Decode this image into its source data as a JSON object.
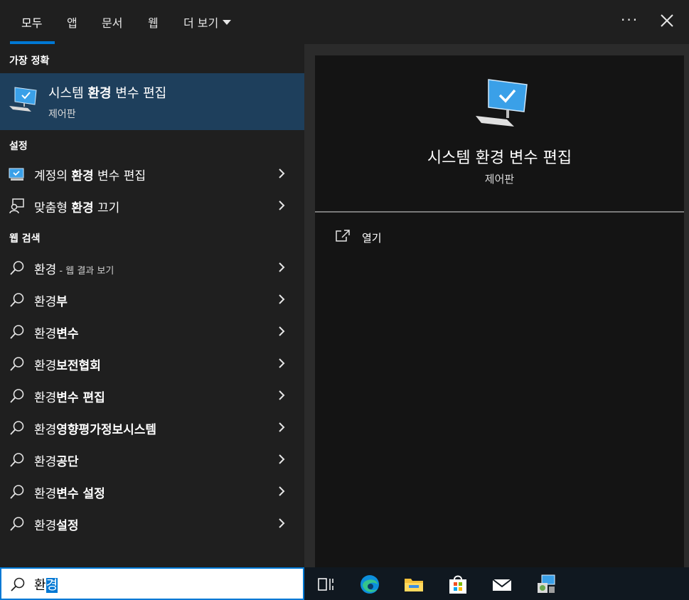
{
  "tabs": [
    {
      "label": "모두",
      "active": true
    },
    {
      "label": "앱",
      "active": false
    },
    {
      "label": "문서",
      "active": false
    },
    {
      "label": "웹",
      "active": false
    },
    {
      "label": "더 보기",
      "active": false
    }
  ],
  "header": {
    "more_options_label": "···",
    "close_icon": "close-icon"
  },
  "best_match": {
    "section_label": "가장 정확",
    "title_pre": "시스템 ",
    "title_bold": "환경",
    "title_post": " 변수 편집",
    "subtitle": "제어판",
    "icon": "monitor-check-icon"
  },
  "settings": {
    "section_label": "설정",
    "items": [
      {
        "pre": "계정의 ",
        "bold": "환경",
        "post": " 변수 편집",
        "icon": "monitor-settings-icon"
      },
      {
        "pre": "맞춤형 ",
        "bold": "환경",
        "post": " 끄기",
        "icon": "person-feedback-icon"
      }
    ]
  },
  "web_search": {
    "section_label": "웹 검색",
    "items": [
      {
        "pre": "환경",
        "bold": "",
        "small": " - 웹 결과 보기"
      },
      {
        "pre": "환경",
        "bold": "부",
        "small": ""
      },
      {
        "pre": "환경",
        "bold": "변수",
        "small": ""
      },
      {
        "pre": "환경",
        "bold": "보전협회",
        "small": ""
      },
      {
        "pre": "환경",
        "bold": "변수 편집",
        "small": ""
      },
      {
        "pre": "환경",
        "bold": "영향평가정보시스템",
        "small": ""
      },
      {
        "pre": "환경",
        "bold": "공단",
        "small": ""
      },
      {
        "pre": "환경",
        "bold": "변수 설정",
        "small": ""
      },
      {
        "pre": "환경",
        "bold": "설정",
        "small": ""
      }
    ]
  },
  "preview": {
    "title": "시스템 환경 변수 편집",
    "subtitle": "제어판",
    "actions": [
      {
        "label": "열기",
        "icon": "open-external-icon"
      }
    ]
  },
  "search": {
    "value_plain": "환",
    "value_selected": "경"
  },
  "taskbar": {
    "items": [
      "task-view-icon",
      "edge-icon",
      "file-explorer-icon",
      "store-icon",
      "mail-icon",
      "control-panel-icon"
    ]
  },
  "colors": {
    "accent": "#0078d4",
    "selected_bg": "#1e3f5c",
    "panel_bg": "#1f1f1f",
    "preview_bg": "#141414"
  }
}
